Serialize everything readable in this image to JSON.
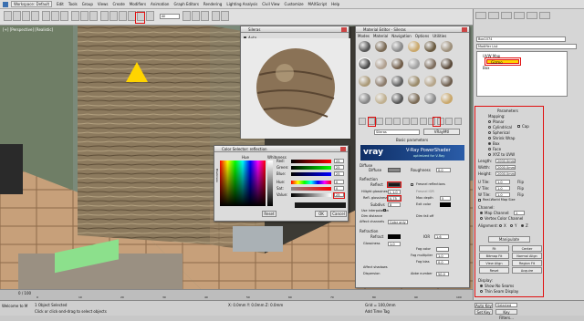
{
  "app": {
    "workspace": "Workspace: Default",
    "menu": [
      "Edit",
      "Tools",
      "Group",
      "Views",
      "Create",
      "Modifiers",
      "Animation",
      "Graph Editors",
      "Rendering",
      "Lighting Analysis",
      "Civil View",
      "Customize",
      "MAXScript",
      "Help"
    ],
    "filter_dropdown": "All"
  },
  "viewport": {
    "label": "[+] [Perspective] [Realistic]"
  },
  "material_editor": {
    "title": "Material Editor - Sileras",
    "menu": [
      "Modes",
      "Material",
      "Navigation",
      "Options",
      "Utilities"
    ],
    "material_name": "Sileras",
    "material_type": "VRayMtl",
    "rollout": "Basic parameters",
    "banner_title": "V-Ray PowerShader",
    "banner_sub": "optimized for V-Ray",
    "diffuse_label": "Diffuse",
    "roughness_label": "Roughness",
    "roughness_value": "0.0",
    "reflection_label": "Reflection",
    "reflect_label": "Reflect",
    "hilight_gloss_label": "Hilight glossiness",
    "hilight_gloss_value": "L 1.0",
    "refl_gloss_label": "Refl. glossiness",
    "refl_gloss_value": "0.75",
    "subdivs_label": "Subdivs",
    "subdivs_value": "8",
    "use_interp_label": "Use interpolation",
    "dim_distance_label": "Dim distance",
    "affect_channels_label": "Affect channels",
    "affect_channels_value": "Color only",
    "fresnel_label": "Fresnel reflections",
    "fresnel_ior_label": "Fresnel IOR",
    "max_depth_label": "Max depth",
    "max_depth_value": "5",
    "exit_color_label": "Exit color",
    "dim_falloff_label": "Dim fall off",
    "refraction_label": "Refraction",
    "refract_label": "Refract",
    "ior_label": "IOR",
    "ior_value": "1.6",
    "glossiness_label": "Glossiness",
    "glossiness_value": "1.0",
    "fog_color_label": "Fog color",
    "fog_multiplier_label": "Fog multiplier",
    "fog_multiplier_value": "1.0",
    "fog_bias_label": "Fog bias",
    "fog_bias_value": "0.0",
    "affect_shadows_label": "Affect shadows",
    "dispersion_label": "Dispersion",
    "abbe_label": "Abbe number",
    "abbe_value": "50.0"
  },
  "sample_preview": {
    "title": "Sileras",
    "auto_label": "Auto"
  },
  "color_selector": {
    "title": "Color Selector: reflection",
    "hue_label": "Hue",
    "whiteness_label": "Whiteness",
    "blackness_label": "Blackness",
    "channels": [
      {
        "label": "Red:",
        "value": "25"
      },
      {
        "label": "Green:",
        "value": "25"
      },
      {
        "label": "Blue:",
        "value": "25"
      },
      {
        "label": "Hue:",
        "value": "0"
      },
      {
        "label": "Sat:",
        "value": "0"
      },
      {
        "label": "Value:",
        "value": "25"
      }
    ],
    "reset_label": "Reset",
    "ok_label": "OK",
    "cancel_label": "Cancel"
  },
  "command_panel": {
    "object_name": "Box1074",
    "modifier_list_label": "Modifier List",
    "stack": [
      "UVW Map",
      "Gizmo",
      "Box"
    ],
    "parameters_title": "Parameters",
    "mapping_label": "Mapping:",
    "mapping_options": [
      "Planar",
      "Cylindrical",
      "Spherical",
      "Shrink Wrap",
      "Box",
      "Face",
      "XYZ to UVW"
    ],
    "cap_label": "Cap",
    "length_label": "Length:",
    "length_value": "2000.0mm",
    "width_label": "Width:",
    "width_value": "2000.0mm",
    "height_label": "Height:",
    "height_value": "2000.0mm",
    "u_tile_label": "U Tile:",
    "u_tile_value": "1.0",
    "v_tile_label": "V Tile:",
    "v_tile_value": "1.0",
    "w_tile_label": "W Tile:",
    "w_tile_value": "1.0",
    "flip_label": "Flip",
    "real_world_label": "Real-World Map Size",
    "channel_label": "Channel:",
    "map_channel_label": "Map Channel:",
    "map_channel_value": "1",
    "vertex_color_label": "Vertex Color Channel",
    "alignment_label": "Alignment:",
    "align_axes": [
      "X",
      "Y",
      "Z"
    ],
    "manipulate_label": "Manipulate",
    "buttons": [
      "Fit",
      "Center",
      "Bitmap Fit",
      "Normal Align",
      "View Align",
      "Region Fit",
      "Reset",
      "Acquire"
    ],
    "display_label": "Display:",
    "show_no_seams": "Show No Seams",
    "thin_seam": "Thin Seam Display"
  },
  "timeline": {
    "frame": "0 / 100",
    "ticks": [
      "0",
      "10",
      "20",
      "30",
      "40",
      "50",
      "60",
      "70",
      "80",
      "90",
      "100"
    ]
  },
  "status": {
    "selected": "1 Object Selected",
    "prompt": "Click or click-and-drag to select objects",
    "welcome": "Welcome to M",
    "coords": "X: 0.0mm   Y: 0.0mm   Z: 0.0mm",
    "grid": "Grid = 100,0mm",
    "autokey": "Auto Key",
    "selected_dd": "Selected",
    "set_key": "Set Key",
    "key_filters": "Key Filters...",
    "add_time_tag": "Add Time Tag"
  },
  "colors": {
    "accent_red": "#e01010",
    "highlight_yellow": "#ffd400",
    "vray_blue": "#1a4a8a"
  }
}
